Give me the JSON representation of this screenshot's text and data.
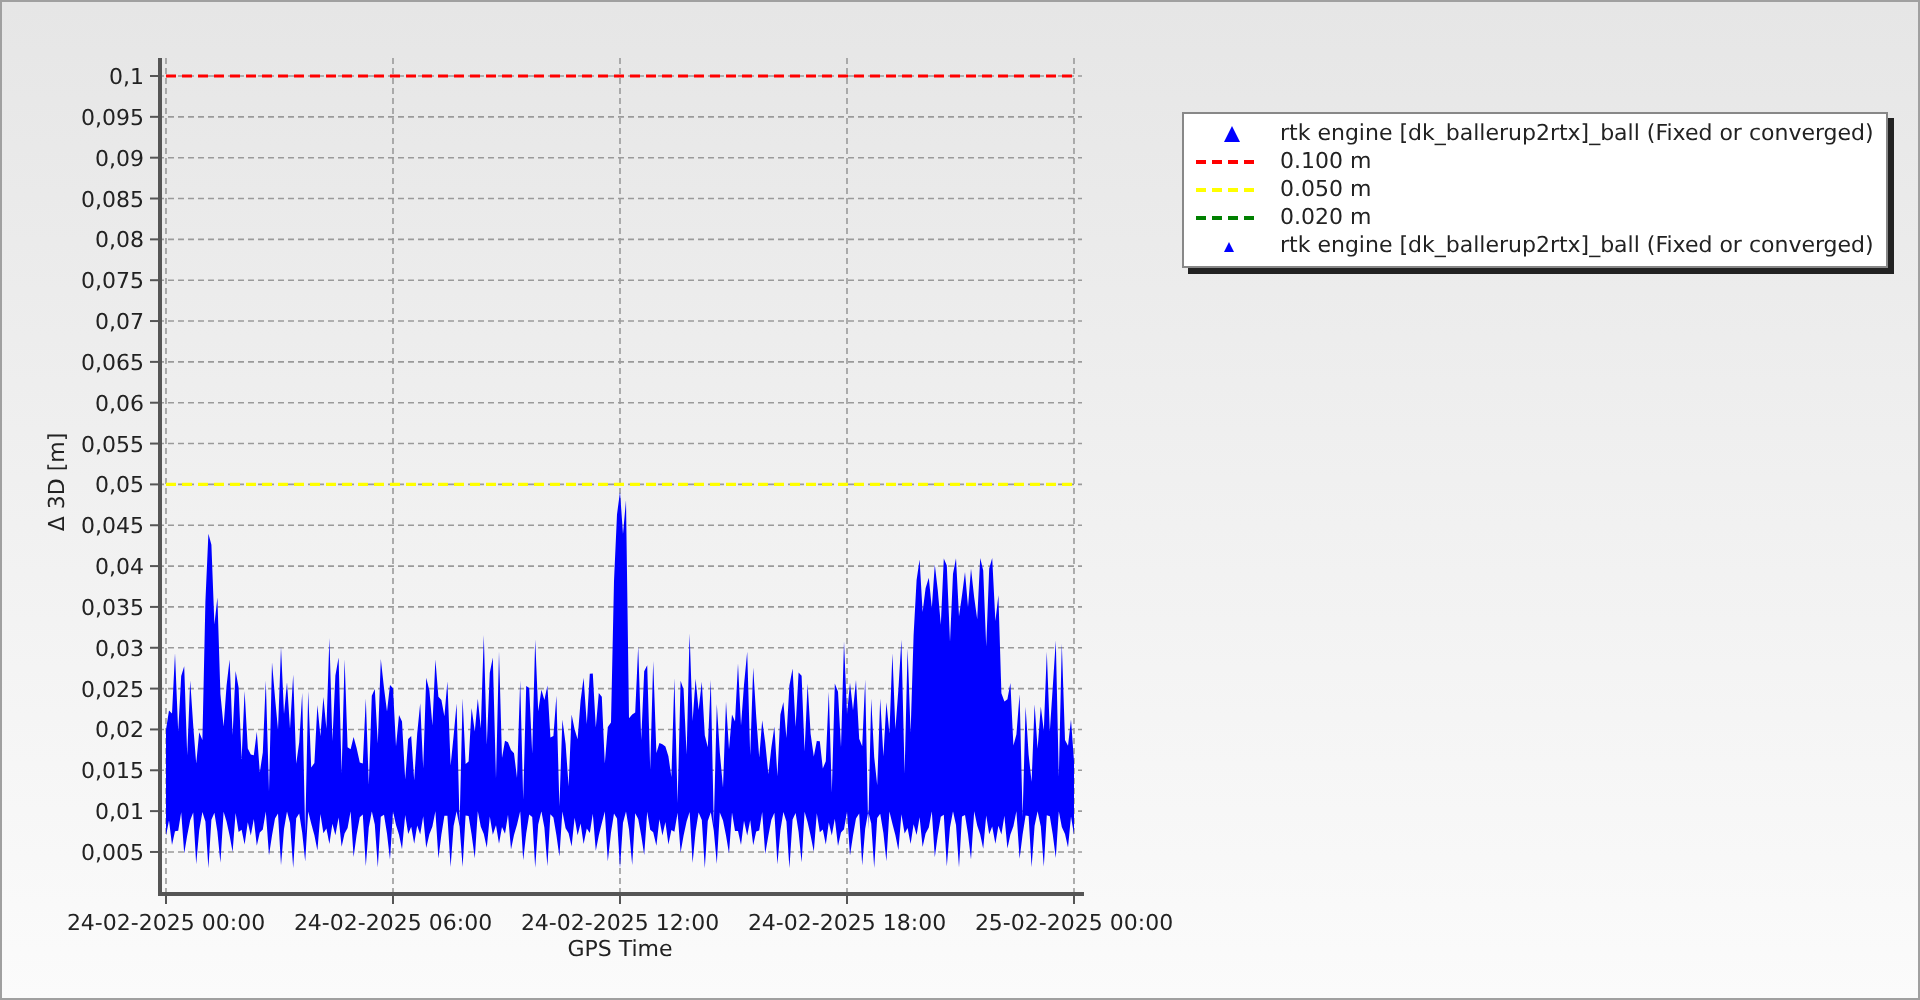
{
  "chart": {
    "chart_data": {
      "type": "line",
      "xlabel": "GPS Time",
      "ylabel": "Δ 3D [m]",
      "categories": [
        "24-02-2025 00:00",
        "24-02-2025 06:00",
        "24-02-2025 12:00",
        "24-02-2025 18:00",
        "25-02-2025 00:00"
      ],
      "ylim": [
        0,
        0.1
      ],
      "grid": true,
      "yticks": [
        {
          "value": 0.1,
          "label": "0,1"
        },
        {
          "value": 0.095,
          "label": "0,095"
        },
        {
          "value": 0.09,
          "label": "0,09"
        },
        {
          "value": 0.085,
          "label": "0,085"
        },
        {
          "value": 0.08,
          "label": "0,08"
        },
        {
          "value": 0.075,
          "label": "0,075"
        },
        {
          "value": 0.07,
          "label": "0,07"
        },
        {
          "value": 0.065,
          "label": "0,065"
        },
        {
          "value": 0.06,
          "label": "0,06"
        },
        {
          "value": 0.055,
          "label": "0,055"
        },
        {
          "value": 0.05,
          "label": "0,05"
        },
        {
          "value": 0.045,
          "label": "0,045"
        },
        {
          "value": 0.04,
          "label": "0,04"
        },
        {
          "value": 0.035,
          "label": "0,035"
        },
        {
          "value": 0.03,
          "label": "0,03"
        },
        {
          "value": 0.025,
          "label": "0,025"
        },
        {
          "value": 0.02,
          "label": "0,02"
        },
        {
          "value": 0.015,
          "label": "0,015"
        },
        {
          "value": 0.01,
          "label": "0,01"
        },
        {
          "value": 0.005,
          "label": "0,005"
        }
      ],
      "series": [
        {
          "color": "#ff0000",
          "line_style": "dashed",
          "values": [
            0.1,
            0.1,
            0.1,
            0.1,
            0.1
          ]
        },
        {
          "color": "#ffff00",
          "line_style": "dashed",
          "values": [
            0.05,
            0.05,
            0.05,
            0.05,
            0.05
          ]
        }
      ]
    },
    "legend": [
      {
        "kind": "large-marker",
        "label": "rtk engine [dk_ballerup2rtx]_ball (Fixed or converged)",
        "color": "#0000ff"
      },
      {
        "kind": "line",
        "label": "0.100 m",
        "color": "#ff0000"
      },
      {
        "kind": "line",
        "label": "0.050 m",
        "color": "#ffff00"
      },
      {
        "kind": "line",
        "label": "0.020 m",
        "color": "#008000"
      },
      {
        "kind": "small-marker",
        "label": "rtk engine [dk_ballerup2rtx]_ball (Fixed or converged)",
        "color": "#0000ff"
      }
    ]
  }
}
